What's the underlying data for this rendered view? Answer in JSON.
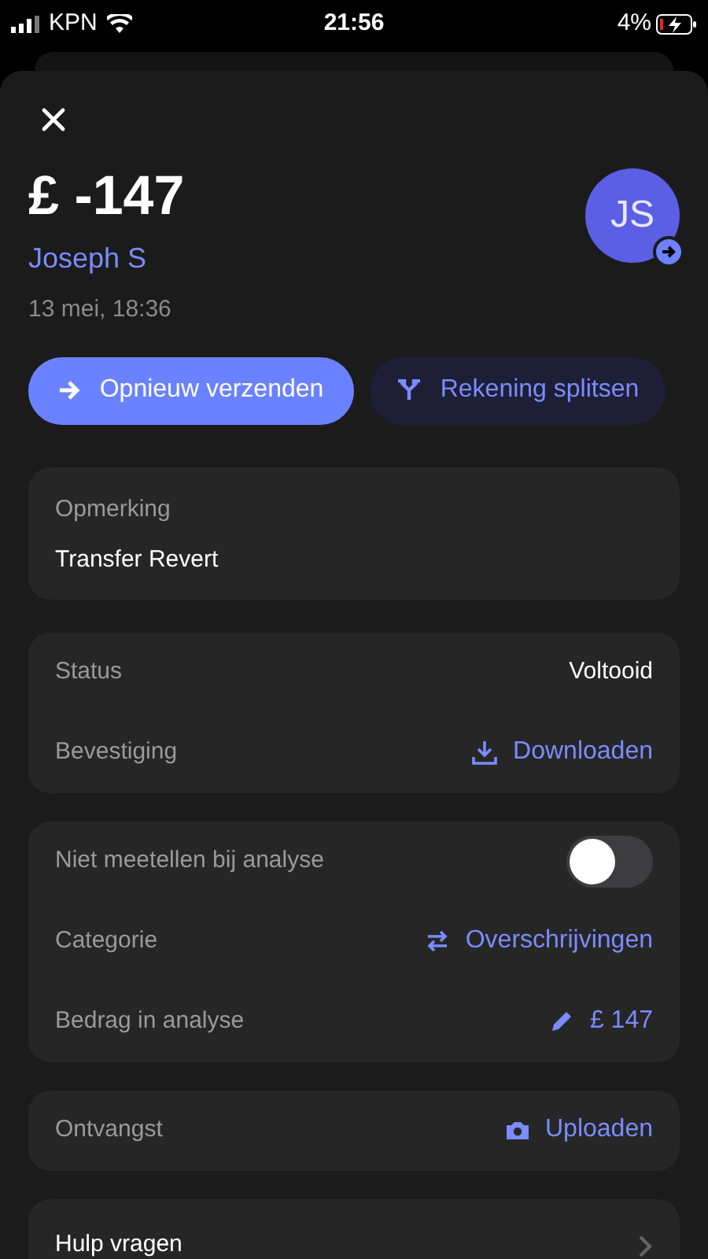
{
  "status_bar": {
    "carrier": "KPN",
    "time": "21:56",
    "battery": "4%"
  },
  "header": {
    "amount": "£ -147",
    "name": "Joseph S",
    "date": "13 mei, 18:36",
    "avatar": "JS"
  },
  "actions": [
    {
      "label": "Opnieuw verzenden",
      "kind": "primary"
    },
    {
      "label": "Rekening splitsen",
      "kind": "secondary"
    }
  ],
  "note": {
    "label": "Opmerking",
    "value": "Transfer Revert"
  },
  "sections": [
    {
      "rows": [
        {
          "kind": "value",
          "label": "Status",
          "value": "Voltooid"
        },
        {
          "kind": "download",
          "label": "Bevestiging",
          "value": "Downloaden"
        }
      ]
    },
    {
      "rows": [
        {
          "kind": "toggle",
          "label": "Niet meetellen bij analyse",
          "on": false
        },
        {
          "kind": "transfer",
          "label": "Categorie",
          "value": "Overschrijvingen"
        },
        {
          "kind": "edit",
          "label": "Bedrag in analyse",
          "value": "£ 147"
        }
      ]
    },
    {
      "rows": [
        {
          "kind": "upload",
          "label": "Ontvangst",
          "value": "Uploaden"
        }
      ]
    },
    {
      "rows": [
        {
          "kind": "link",
          "label": "Hulp vragen"
        }
      ]
    }
  ]
}
